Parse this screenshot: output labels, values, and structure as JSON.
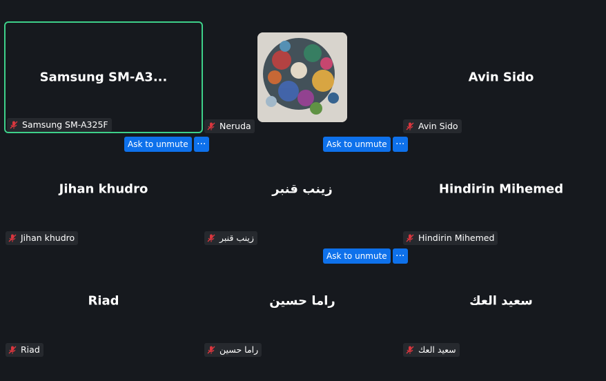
{
  "ask_to_unmute_label": "Ask to unmute",
  "more_label": "···",
  "colors": {
    "background": "#16191e",
    "active_border": "#3ed18a",
    "button": "#0e71eb",
    "label_bg": "#26292e",
    "muted_icon": "#d9363e"
  },
  "participants": [
    {
      "display_name": "Samsung  SM-A3...",
      "label": "Samsung SM-A325F",
      "muted": true,
      "active_speaker": true
    },
    {
      "display_name": "",
      "label": "Neruda",
      "muted": true,
      "has_photo": true
    },
    {
      "display_name": "Avin Sido",
      "label": "Avin Sido",
      "muted": true
    },
    {
      "display_name": "Jihan khudro",
      "label": "Jihan khudro",
      "muted": true
    },
    {
      "display_name": "زينب قنبر",
      "label": "زينب قنبر",
      "muted": true
    },
    {
      "display_name": "Hindirin Mihemed",
      "label": "Hindirin Mihemed",
      "muted": true
    },
    {
      "display_name": "Riad",
      "label": "Riad",
      "muted": true
    },
    {
      "display_name": "راما حسين",
      "label": "راما حسين",
      "muted": true
    },
    {
      "display_name": "سعيد العك",
      "label": "سعيد العك",
      "muted": true
    }
  ]
}
